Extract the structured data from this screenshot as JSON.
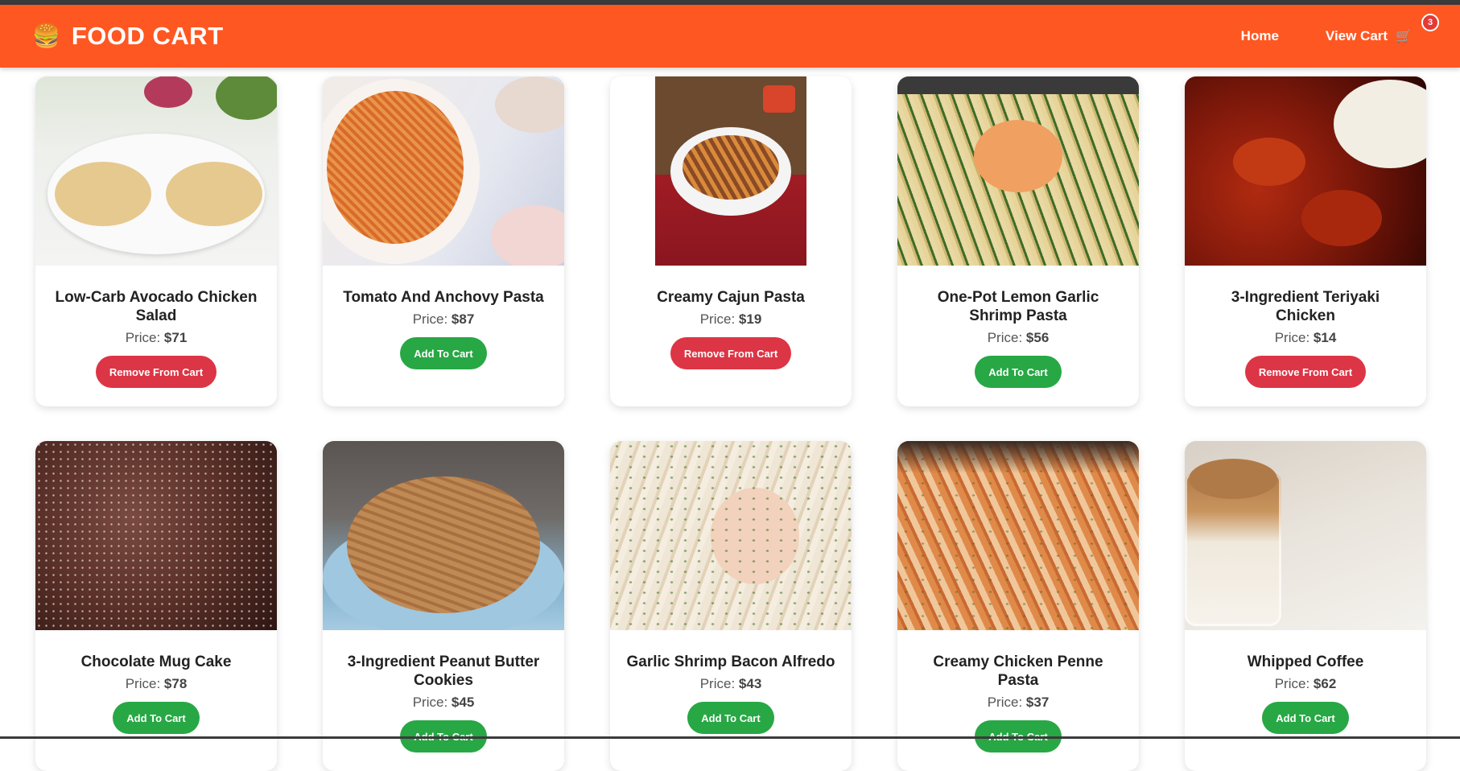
{
  "header": {
    "brand_icon": "burger-icon",
    "brand_title": "FOOD CART",
    "nav": {
      "home_label": "Home",
      "cart_label": "View Cart",
      "cart_icon": "cart-icon",
      "cart_count": "3"
    }
  },
  "colors": {
    "navbar": "#ff5722",
    "add_button": "#28a745",
    "remove_button": "#dc3545",
    "badge": "#e53935"
  },
  "products": [
    {
      "name": "Low-Carb Avocado Chicken Salad",
      "price_label": "Price: ",
      "price": "$71",
      "button": "Remove From Cart",
      "in_cart": true,
      "image": "chicken-salad-image"
    },
    {
      "name": "Tomato And Anchovy Pasta",
      "price_label": "Price: ",
      "price": "$87",
      "button": "Add To Cart",
      "in_cart": false,
      "image": "tomato-pasta-image"
    },
    {
      "name": "Creamy Cajun Pasta",
      "price_label": "Price: ",
      "price": "$19",
      "button": "Remove From Cart",
      "in_cart": true,
      "image": "cajun-pasta-image"
    },
    {
      "name": "One-Pot Lemon Garlic Shrimp Pasta",
      "price_label": "Price: ",
      "price": "$56",
      "button": "Add To Cart",
      "in_cart": false,
      "image": "shrimp-pasta-image"
    },
    {
      "name": "3-Ingredient Teriyaki Chicken",
      "price_label": "Price: ",
      "price": "$14",
      "button": "Remove From Cart",
      "in_cart": true,
      "image": "teriyaki-chicken-image"
    },
    {
      "name": "Chocolate Mug Cake",
      "price_label": "Price: ",
      "price": "$78",
      "button": "Add To Cart",
      "in_cart": false,
      "image": "mug-cake-image"
    },
    {
      "name": "3-Ingredient Peanut Butter Cookies",
      "price_label": "Price: ",
      "price": "$45",
      "button": "Add To Cart",
      "in_cart": false,
      "image": "peanut-cookies-image"
    },
    {
      "name": "Garlic Shrimp Bacon Alfredo",
      "price_label": "Price: ",
      "price": "$43",
      "button": "Add To Cart",
      "in_cart": false,
      "image": "shrimp-alfredo-image"
    },
    {
      "name": "Creamy Chicken Penne Pasta",
      "price_label": "Price: ",
      "price": "$37",
      "button": "Add To Cart",
      "in_cart": false,
      "image": "penne-pasta-image"
    },
    {
      "name": "Whipped Coffee",
      "price_label": "Price: ",
      "price": "$62",
      "button": "Add To Cart",
      "in_cart": false,
      "image": "whipped-coffee-image"
    }
  ]
}
